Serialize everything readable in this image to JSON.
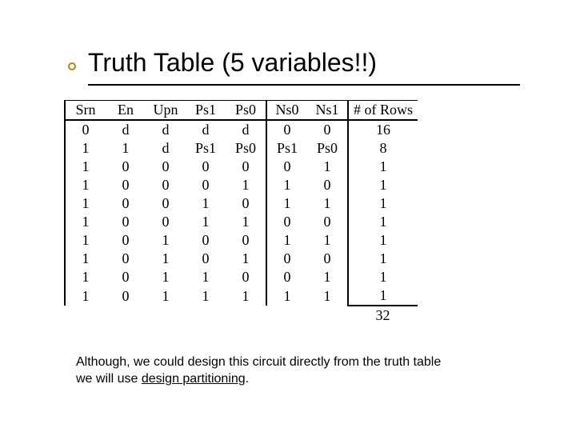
{
  "title": "Truth Table  (5 variables!!)",
  "headers": [
    "Srn",
    "En",
    "Upn",
    "Ps1",
    "Ps0",
    "Ns0",
    "Ns1",
    "# of Rows"
  ],
  "rows": [
    [
      "0",
      "d",
      "d",
      "d",
      "d",
      "0",
      "0",
      "16"
    ],
    [
      "1",
      "1",
      "d",
      "Ps1",
      "Ps0",
      "Ps1",
      "Ps0",
      "8"
    ],
    [
      "1",
      "0",
      "0",
      "0",
      "0",
      "0",
      "1",
      "1"
    ],
    [
      "1",
      "0",
      "0",
      "0",
      "1",
      "1",
      "0",
      "1"
    ],
    [
      "1",
      "0",
      "0",
      "1",
      "0",
      "1",
      "1",
      "1"
    ],
    [
      "1",
      "0",
      "0",
      "1",
      "1",
      "0",
      "0",
      "1"
    ],
    [
      "1",
      "0",
      "1",
      "0",
      "0",
      "1",
      "1",
      "1"
    ],
    [
      "1",
      "0",
      "1",
      "0",
      "1",
      "0",
      "0",
      "1"
    ],
    [
      "1",
      "0",
      "1",
      "1",
      "0",
      "0",
      "1",
      "1"
    ],
    [
      "1",
      "0",
      "1",
      "1",
      "1",
      "1",
      "1",
      "1"
    ]
  ],
  "sum": "32",
  "caption_line1": "Although, we could design this circuit directly from the truth table",
  "caption_line2_a": "we will use ",
  "caption_line2_b": "design partitioning",
  "caption_line2_c": "."
}
